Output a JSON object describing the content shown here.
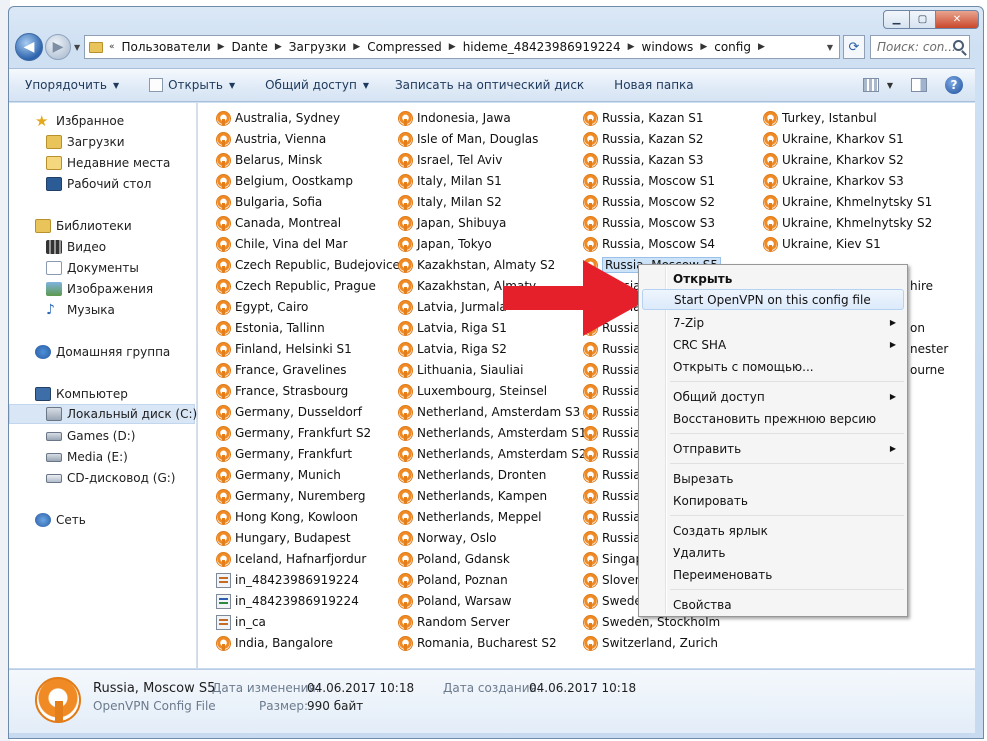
{
  "window": {
    "buttons": {
      "minimize": "▁",
      "maximize": "▢",
      "close": "✕"
    }
  },
  "address": {
    "parts": [
      "Пользователи",
      "Dante",
      "Загрузки",
      "Compressed",
      "hideme_48423986919224",
      "windows",
      "config"
    ],
    "lead": "«",
    "search_placeholder": "Поиск: con..."
  },
  "toolbar": {
    "organize": "Упорядочить",
    "open": "Открыть",
    "share": "Общий доступ",
    "burn": "Записать на оптический диск",
    "new_folder": "Новая папка"
  },
  "nav": {
    "favorites": "Избранное",
    "downloads": "Загрузки",
    "recent": "Недавние места",
    "desktop": "Рабочий стол",
    "libraries": "Библиотеки",
    "video": "Видео",
    "documents": "Документы",
    "images": "Изображения",
    "music": "Музыка",
    "homegroup": "Домашняя группа",
    "computer": "Компьютер",
    "local_disk": "Локальный диск (C:)",
    "games": "Games (D:)",
    "media": "Media (E:)",
    "cd": "CD-дисковод (G:)",
    "network": "Сеть"
  },
  "files": {
    "col1": [
      "Australia, Sydney",
      "Austria, Vienna",
      "Belarus, Minsk",
      "Belgium, Oostkamp",
      "Bulgaria, Sofia",
      "Canada, Montreal",
      "Chile, Vina del Mar",
      "Czech Republic, Budejovice",
      "Czech Republic, Prague",
      "Egypt, Cairo",
      "Estonia, Tallinn",
      "Finland, Helsinki S1",
      "France, Gravelines",
      "France, Strasbourg",
      "Germany, Dusseldorf",
      "Germany, Frankfurt S2",
      "Germany, Frankfurt",
      "Germany, Munich",
      "Germany, Nuremberg",
      "Hong Kong, Kowloon",
      "Hungary, Budapest",
      "Iceland, Hafnarfjordur",
      "in_48423986919224",
      "in_48423986919224",
      "in_ca",
      "India, Bangalore"
    ],
    "col2": [
      "Indonesia, Jawa",
      "Isle of Man, Douglas",
      "Israel, Tel Aviv",
      "Italy, Milan S1",
      "Italy, Milan S2",
      "Japan, Shibuya",
      "Japan, Tokyo",
      "Kazakhstan, Almaty S2",
      "Kazakhstan, Almaty",
      "Latvia, Jurmala",
      "Latvia, Riga S1",
      "Latvia, Riga S2",
      "Lithuania, Siauliai",
      "Luxembourg, Steinsel",
      "Netherland, Amsterdam S3",
      "Netherlands, Amsterdam S1",
      "Netherlands, Amsterdam S2",
      "Netherlands, Dronten",
      "Netherlands, Kampen",
      "Netherlands, Meppel",
      "Norway, Oslo",
      "Poland, Gdansk",
      "Poland, Poznan",
      "Poland, Warsaw",
      "Random Server",
      "Romania, Bucharest S2"
    ],
    "col3": [
      "Russia, Kazan S1",
      "Russia, Kazan S2",
      "Russia, Kazan S3",
      "Russia, Moscow S1",
      "Russia, Moscow S2",
      "Russia, Moscow S3",
      "Russia, Moscow S4",
      "Russia, Moscow S5",
      "Russia",
      "Russia",
      "Russia",
      "Russia",
      "Russia",
      "Russia",
      "Russia",
      "Russia",
      "Russia",
      "Russia",
      "Russia",
      "Russia",
      "Russia",
      "Singap",
      "Sloven",
      "Sweden",
      "Sweden, Stockholm",
      "Switzerland, Zurich"
    ],
    "col4": [
      "Turkey, Istanbul",
      "Ukraine, Kharkov S1",
      "Ukraine, Kharkov S2",
      "Ukraine, Kharkov S3",
      "Ukraine, Khmelnytsky S1",
      "Ukraine, Khmelnytsky S2",
      "Ukraine, Kiev S1"
    ],
    "col4_partial": [
      "hire",
      "on",
      "nester",
      "ourne"
    ]
  },
  "context_menu": {
    "open": "Открыть",
    "start_openvpn": "Start OpenVPN on this config file",
    "zip": "7-Zip",
    "crc": "CRC SHA",
    "open_with": "Открыть с помощью...",
    "share": "Общий доступ",
    "restore": "Восстановить прежнюю версию",
    "send_to": "Отправить",
    "cut": "Вырезать",
    "copy": "Копировать",
    "shortcut": "Создать ярлык",
    "delete": "Удалить",
    "rename": "Переименовать",
    "properties": "Свойства"
  },
  "details": {
    "name": "Russia, Moscow S5",
    "type": "OpenVPN Config File",
    "modified_label": "Дата изменения:",
    "modified_value": "04.06.2017 10:18",
    "created_label": "Дата создания:",
    "created_value": "04.06.2017 10:18",
    "size_label": "Размер:",
    "size_value": "990 байт"
  },
  "colors": {
    "accent_orange": "#f08a24",
    "arrow_red": "#e5202a",
    "selection": "#cde3f8"
  }
}
